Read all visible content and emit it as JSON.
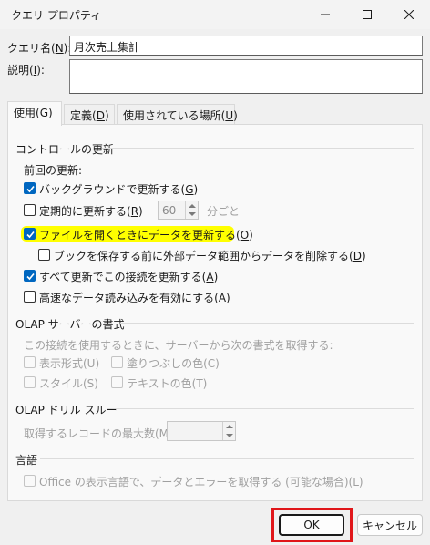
{
  "window": {
    "title": "クエリ プロパティ"
  },
  "query_name": {
    "label_prefix": "クエリ名(",
    "label_key": "N",
    "label_suffix": "):",
    "value": "月次売上集計"
  },
  "description": {
    "label_prefix": "説明(",
    "label_key": "I",
    "label_suffix": "):",
    "value": ""
  },
  "tabs": [
    {
      "prefix": "使用(",
      "key": "G",
      "suffix": ")"
    },
    {
      "prefix": "定義(",
      "key": "D",
      "suffix": ")"
    },
    {
      "prefix": "使用されている場所(",
      "key": "U",
      "suffix": ")"
    }
  ],
  "refresh_control": {
    "section_title": "コントロールの更新",
    "last_refresh_label": "前回の更新:",
    "background_refresh": {
      "prefix": "バックグラウンドで更新する(",
      "key": "G",
      "suffix": ")",
      "checked": true
    },
    "periodic_refresh": {
      "prefix": "定期的に更新する(",
      "key": "R",
      "suffix": ")",
      "checked": false,
      "minutes": "60",
      "unit": "分ごと"
    },
    "refresh_on_open": {
      "prefix": "ファイルを開くときにデータを更新する(",
      "key": "O",
      "suffix": ")",
      "checked": true
    },
    "remove_external_data": {
      "prefix": "ブックを保存する前に外部データ範囲からデータを削除する(",
      "key": "D",
      "suffix": ")",
      "checked": false
    },
    "refresh_all": {
      "prefix": "すべて更新でこの接続を更新する(",
      "key": "A",
      "suffix": ")",
      "checked": true
    },
    "fast_load": {
      "prefix": "高速なデータ読み込みを有効にする(",
      "key": "A",
      "suffix": ")",
      "checked": false
    }
  },
  "olap_formats": {
    "section_title": "OLAP サーバーの書式",
    "description": "この接続を使用するときに、サーバーから次の書式を取得する:",
    "number_format": "表示形式(U)",
    "fill_color": "塗りつぶしの色(C)",
    "font_style": "スタイル(S)",
    "text_color": "テキストの色(T)"
  },
  "olap_drill": {
    "section_title": "OLAP ドリル スルー",
    "max_records_label": "取得するレコードの最大数(M):",
    "max_records_value": ""
  },
  "language": {
    "section_title": "言語",
    "office_language": "Office の表示言語で、データとエラーを取得する (可能な場合)(L)"
  },
  "buttons": {
    "ok": "OK",
    "cancel": "キャンセル"
  },
  "colors": {
    "accent": "#0067c0",
    "highlight": "#ffff00",
    "annotation_box": "#e0161a"
  }
}
